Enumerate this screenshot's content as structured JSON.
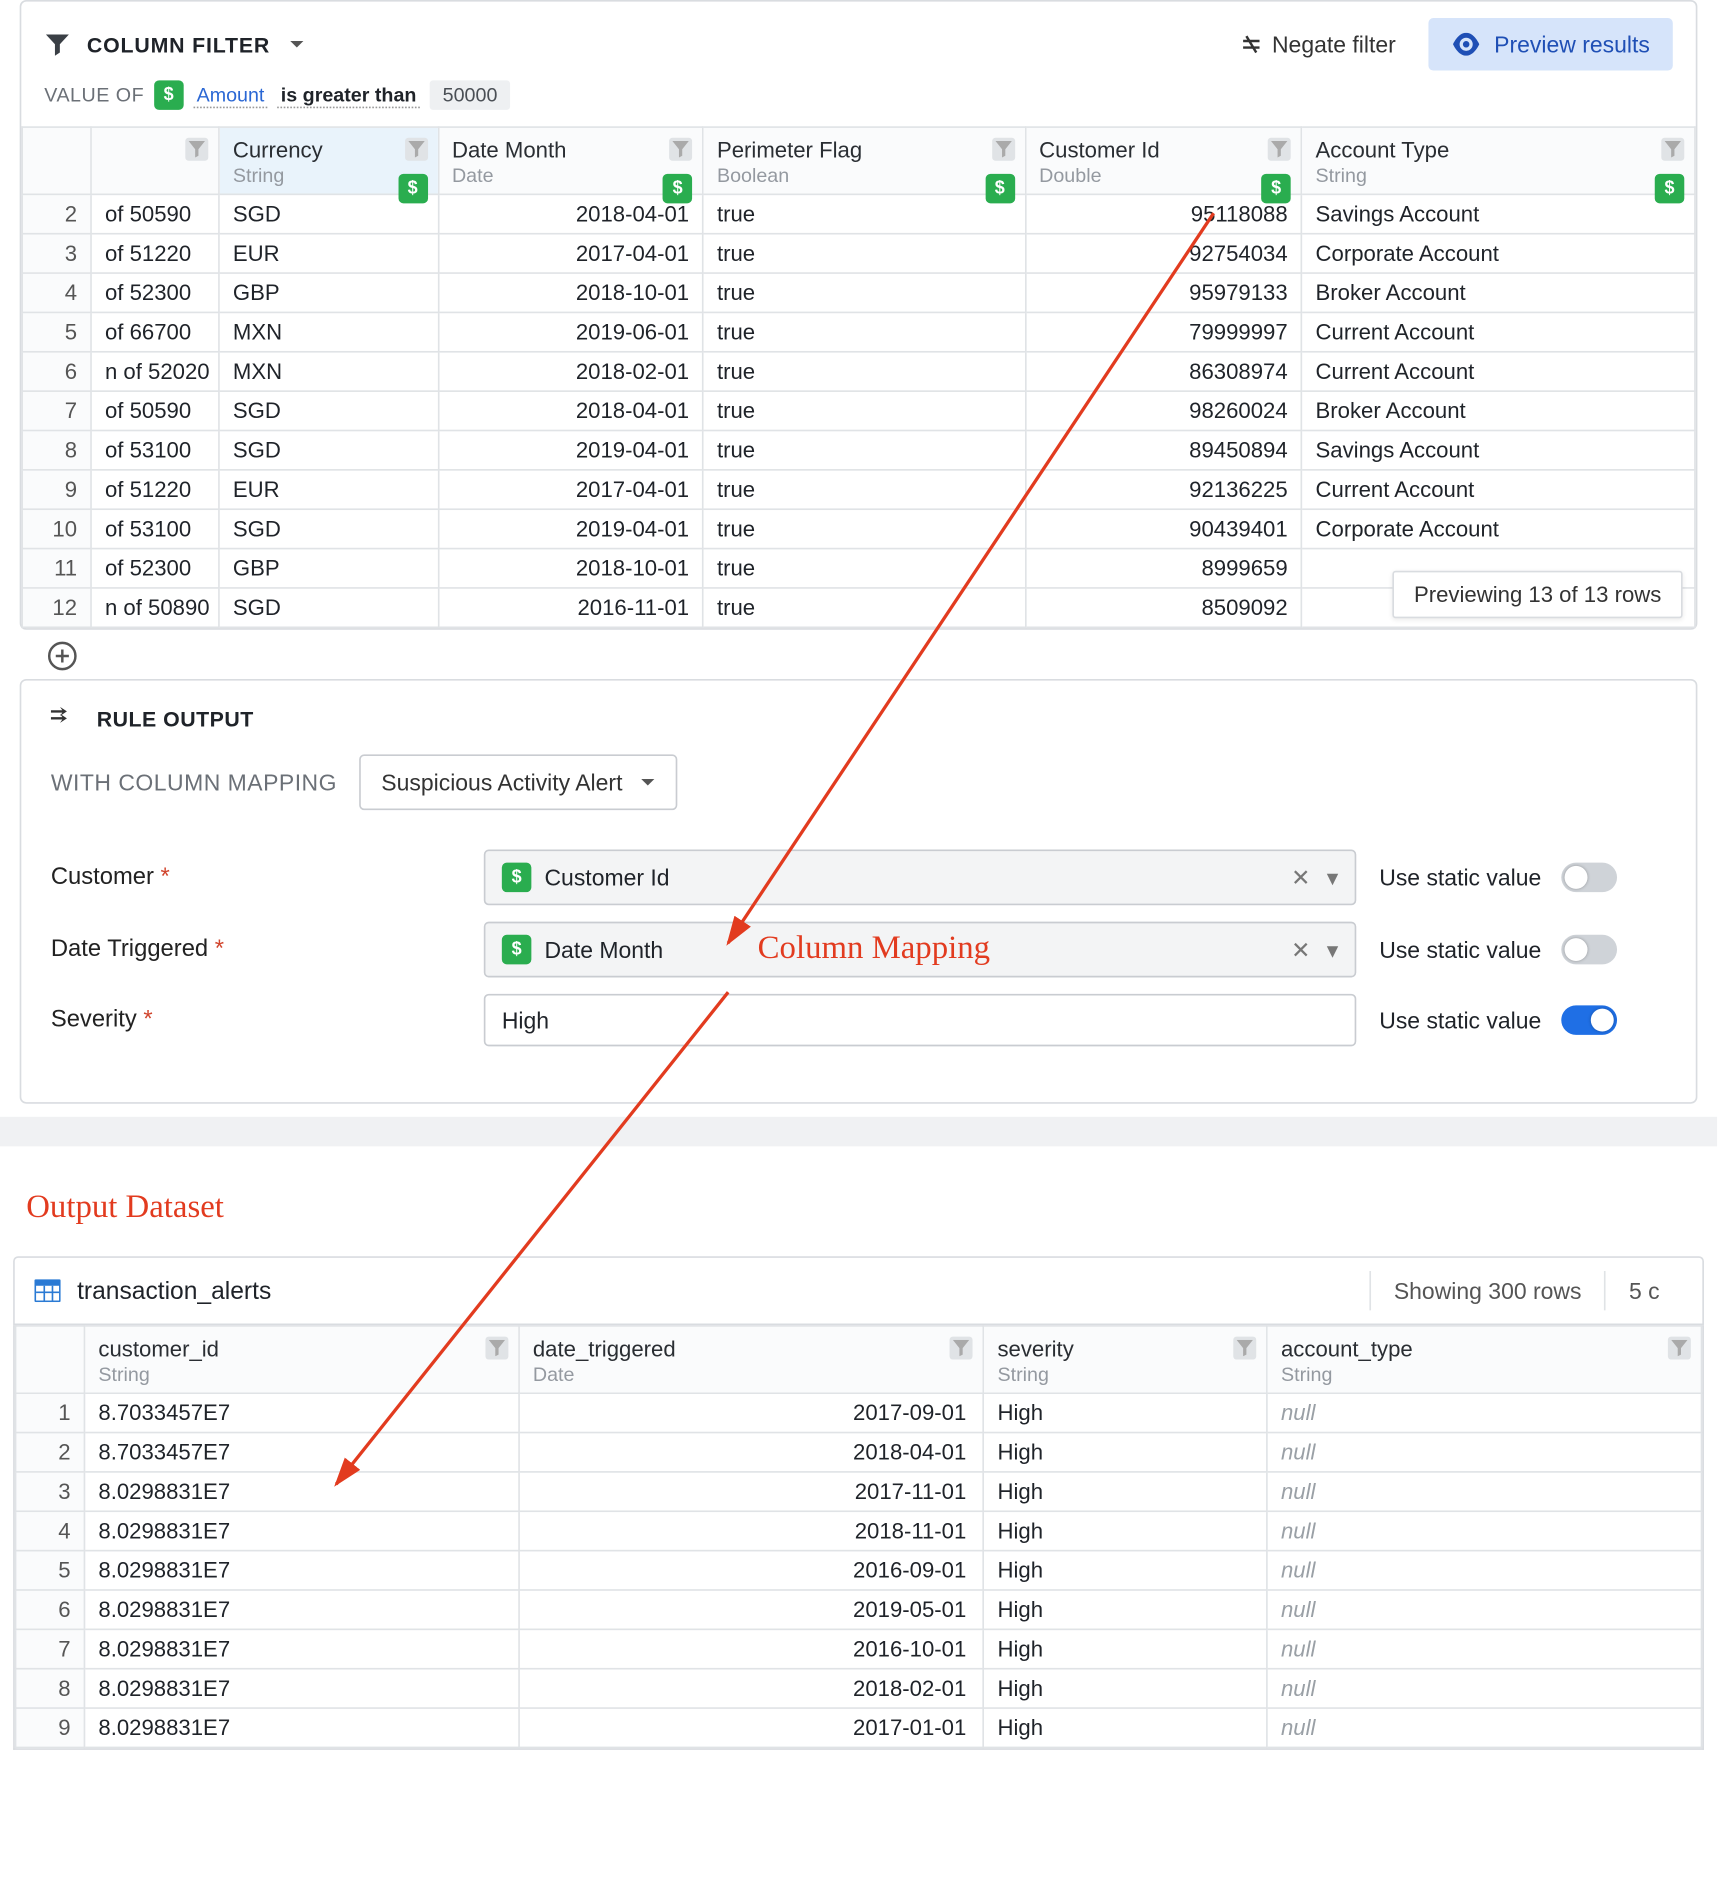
{
  "filter": {
    "section_title": "COLUMN FILTER",
    "negate_label": "Negate filter",
    "preview_label": "Preview results",
    "value_of_label": "VALUE OF",
    "column": "Amount",
    "operator": "is greater than",
    "value": "50000"
  },
  "columns": [
    {
      "name": "Currency",
      "type": "String",
      "selected": true
    },
    {
      "name": "Date Month",
      "type": "Date"
    },
    {
      "name": "Perimeter Flag",
      "type": "Boolean"
    },
    {
      "name": "Customer Id",
      "type": "Double"
    },
    {
      "name": "Account Type",
      "type": "String"
    }
  ],
  "rows": [
    {
      "n": 2,
      "desc": "of 50590",
      "cur": "SGD",
      "date": "2018-04-01",
      "flag": "true",
      "cust": "95118088",
      "acct": "Savings Account"
    },
    {
      "n": 3,
      "desc": "of 51220",
      "cur": "EUR",
      "date": "2017-04-01",
      "flag": "true",
      "cust": "92754034",
      "acct": "Corporate Account"
    },
    {
      "n": 4,
      "desc": "of 52300",
      "cur": "GBP",
      "date": "2018-10-01",
      "flag": "true",
      "cust": "95979133",
      "acct": "Broker Account"
    },
    {
      "n": 5,
      "desc": "of 66700",
      "cur": "MXN",
      "date": "2019-06-01",
      "flag": "true",
      "cust": "79999997",
      "acct": "Current Account"
    },
    {
      "n": 6,
      "desc": "n of 52020",
      "cur": "MXN",
      "date": "2018-02-01",
      "flag": "true",
      "cust": "86308974",
      "acct": "Current Account"
    },
    {
      "n": 7,
      "desc": "of 50590",
      "cur": "SGD",
      "date": "2018-04-01",
      "flag": "true",
      "cust": "98260024",
      "acct": "Broker Account"
    },
    {
      "n": 8,
      "desc": "of 53100",
      "cur": "SGD",
      "date": "2019-04-01",
      "flag": "true",
      "cust": "89450894",
      "acct": "Savings Account"
    },
    {
      "n": 9,
      "desc": "of 51220",
      "cur": "EUR",
      "date": "2017-04-01",
      "flag": "true",
      "cust": "92136225",
      "acct": "Current Account"
    },
    {
      "n": 10,
      "desc": "of 53100",
      "cur": "SGD",
      "date": "2019-04-01",
      "flag": "true",
      "cust": "90439401",
      "acct": "Corporate Account"
    },
    {
      "n": 11,
      "desc": "of 52300",
      "cur": "GBP",
      "date": "2018-10-01",
      "flag": "true",
      "cust": "8999659",
      "acct": ""
    },
    {
      "n": 12,
      "desc": "n of 50890",
      "cur": "SGD",
      "date": "2016-11-01",
      "flag": "true",
      "cust": "8509092",
      "acct": ""
    }
  ],
  "preview_toast": "Previewing 13 of 13 rows",
  "rule_output": {
    "section_title": "RULE OUTPUT",
    "with_mapping_label": "WITH COLUMN MAPPING",
    "mapping_name": "Suspicious Activity Alert",
    "use_static_label": "Use static value",
    "fields": [
      {
        "label": "Customer",
        "value": "Customer Id",
        "static": false,
        "plain": false
      },
      {
        "label": "Date Triggered",
        "value": "Date Month",
        "static": false,
        "plain": false
      },
      {
        "label": "Severity",
        "value": "High",
        "static": true,
        "plain": true
      }
    ]
  },
  "annotation_mapping": "Column Mapping",
  "annotation_output": "Output Dataset",
  "output_dataset": {
    "name": "transaction_alerts",
    "stats": {
      "rows": "Showing 300 rows",
      "cols": "5 c"
    },
    "columns": [
      {
        "name": "customer_id",
        "type": "String"
      },
      {
        "name": "date_triggered",
        "type": "Date"
      },
      {
        "name": "severity",
        "type": "String"
      },
      {
        "name": "account_type",
        "type": "String"
      }
    ],
    "rows": [
      {
        "n": 1,
        "cust": "8.7033457E7",
        "date": "2017-09-01",
        "sev": "High",
        "acct": "null"
      },
      {
        "n": 2,
        "cust": "8.7033457E7",
        "date": "2018-04-01",
        "sev": "High",
        "acct": "null"
      },
      {
        "n": 3,
        "cust": "8.0298831E7",
        "date": "2017-11-01",
        "sev": "High",
        "acct": "null"
      },
      {
        "n": 4,
        "cust": "8.0298831E7",
        "date": "2018-11-01",
        "sev": "High",
        "acct": "null"
      },
      {
        "n": 5,
        "cust": "8.0298831E7",
        "date": "2016-09-01",
        "sev": "High",
        "acct": "null"
      },
      {
        "n": 6,
        "cust": "8.0298831E7",
        "date": "2019-05-01",
        "sev": "High",
        "acct": "null"
      },
      {
        "n": 7,
        "cust": "8.0298831E7",
        "date": "2016-10-01",
        "sev": "High",
        "acct": "null"
      },
      {
        "n": 8,
        "cust": "8.0298831E7",
        "date": "2018-02-01",
        "sev": "High",
        "acct": "null"
      },
      {
        "n": 9,
        "cust": "8.0298831E7",
        "date": "2017-01-01",
        "sev": "High",
        "acct": "null"
      }
    ]
  }
}
